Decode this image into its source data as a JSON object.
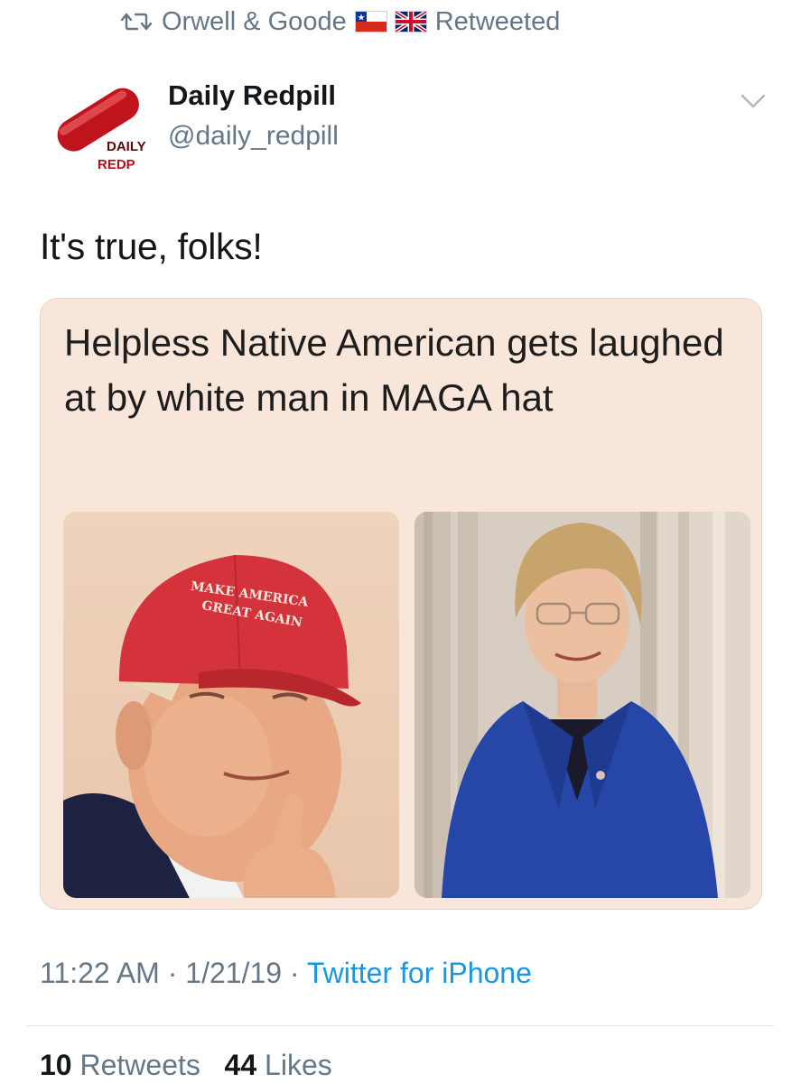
{
  "retweet": {
    "user": "Orwell & Goode",
    "flags": [
      "chile-flag",
      "uk-flag"
    ],
    "label": "Retweeted"
  },
  "author": {
    "display_name": "Daily Redpill",
    "handle": "@daily_redpill",
    "avatar_text_line1": "DAILY",
    "avatar_text_line2": "REDP"
  },
  "tweet": {
    "text": "It's true, folks!"
  },
  "card": {
    "caption": "Helpless Native American gets laughed at by white man in MAGA hat",
    "hat_text_line1": "MAKE AMERICA",
    "hat_text_line2": "GREAT AGAIN"
  },
  "meta": {
    "time": "11:22 AM",
    "date": "1/21/19",
    "separator": "·",
    "source": "Twitter for iPhone"
  },
  "stats": {
    "retweets_count": "10",
    "retweets_label": "Retweets",
    "likes_count": "44",
    "likes_label": "Likes"
  },
  "colors": {
    "secondary_text": "#657786",
    "link": "#1b95e0",
    "card_bg": "#f8e6db",
    "hat_red": "#d4333b",
    "blazer_blue": "#2647a8"
  }
}
